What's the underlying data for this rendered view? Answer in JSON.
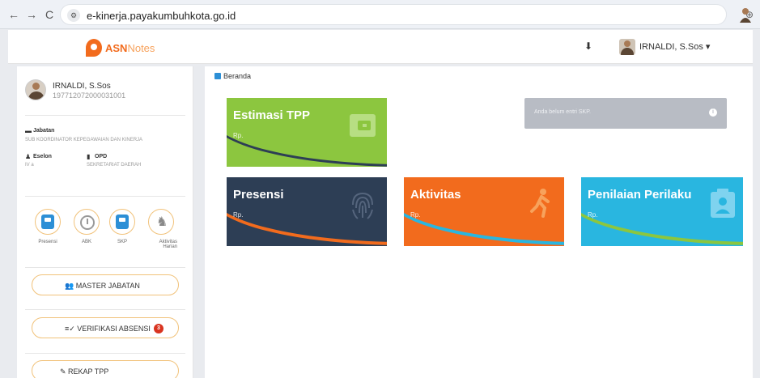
{
  "browser": {
    "back": "←",
    "forward": "→",
    "reload": "C",
    "url": "e-kinerja.payakumbuhkota.go.id",
    "zoom_icon": "⊕",
    "bookmark_icon": "☆"
  },
  "header": {
    "logo_asn": "ASN",
    "logo_notes": "Notes",
    "download_icon": "⬇",
    "user_label": "IRNALDI, S.Sos ▾"
  },
  "sidebar": {
    "name": "IRNALDI, S.Sos",
    "nip": "197712072000031001",
    "jabatan_label": "Jabatan",
    "jabatan_value": "SUB KOORDINATOR KEPEGAWAIAN DAN KINERJA",
    "eselon_label": "Eselon",
    "eselon_value": "IV a",
    "opd_label": "OPD",
    "opd_value": "SEKRETARIAT DAERAH",
    "menu": [
      {
        "label": "Presensi"
      },
      {
        "label": "ABK"
      },
      {
        "label": "SKP"
      },
      {
        "label": "Aktivitas Harian"
      }
    ],
    "btn_master": "👥 MASTER JABATAN",
    "btn_verifikasi": "≡✓ VERIFIKASI ABSENSI",
    "verifikasi_badge": "3",
    "btn_rekap": "✎ REKAP TPP"
  },
  "main": {
    "breadcrumb": "Beranda",
    "cards": {
      "tpp": {
        "title": "Estimasi TPP",
        "sub": "Rp."
      },
      "presensi": {
        "title": "Presensi",
        "sub": "Rp."
      },
      "aktivitas": {
        "title": "Aktivitas",
        "sub": "Rp."
      },
      "penilaian": {
        "title": "Penilaian Perilaku",
        "sub": "Rp."
      }
    },
    "notice": "Anda belum entri SKP.",
    "notice_icon": "i"
  },
  "colors": {
    "tpp": "#8cc63f",
    "presensi": "#2d3e55",
    "aktivitas": "#f26b1d",
    "penilaian": "#29b6e0",
    "accent": "#f26b1d"
  }
}
